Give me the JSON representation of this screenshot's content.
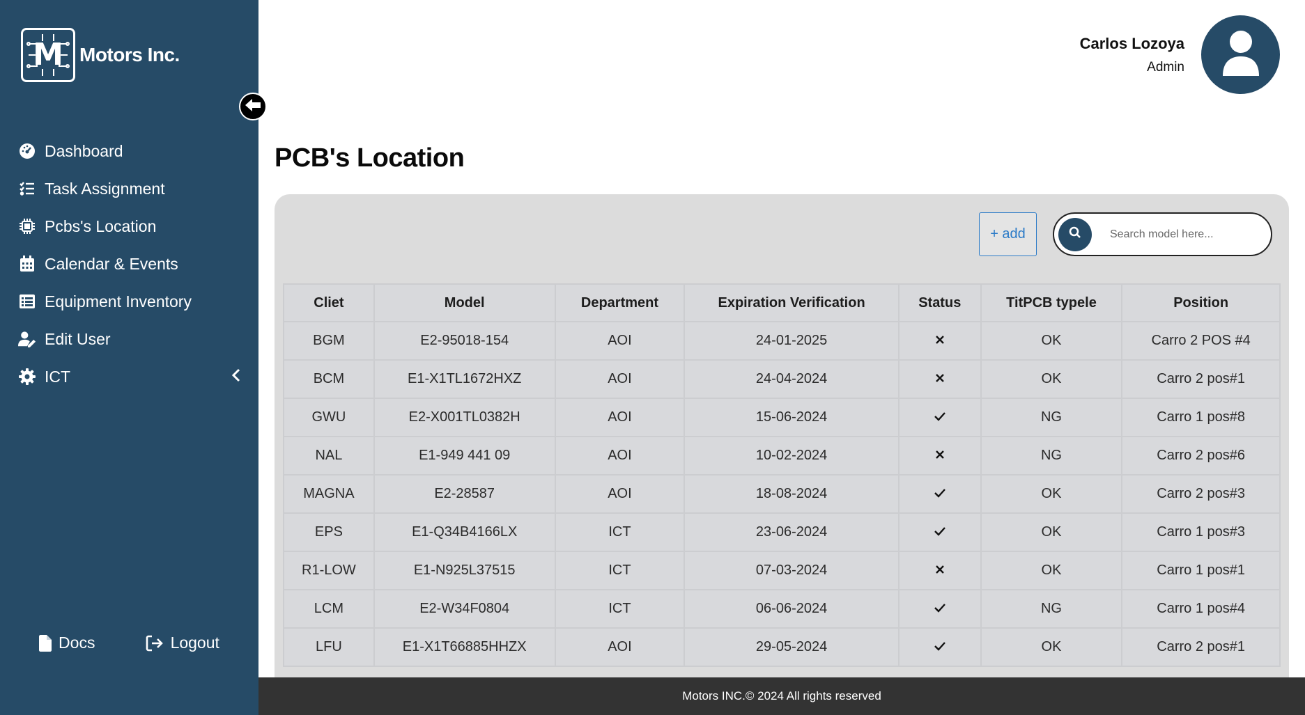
{
  "brand": {
    "logo_letter": "M",
    "name": "Motors Inc."
  },
  "sidebar": {
    "items": [
      {
        "label": "Dashboard",
        "icon": "gauge-icon"
      },
      {
        "label": "Task Assignment",
        "icon": "list-check-icon"
      },
      {
        "label": "Pcbs's Location",
        "icon": "microchip-icon"
      },
      {
        "label": "Calendar & Events",
        "icon": "calendar-icon"
      },
      {
        "label": "Equipment Inventory",
        "icon": "table-list-icon"
      },
      {
        "label": "Edit User",
        "icon": "user-pen-icon"
      },
      {
        "label": "ICT",
        "icon": "gear-icon"
      }
    ],
    "docs_label": "Docs",
    "logout_label": "Logout"
  },
  "header": {
    "user_name": "Carlos Lozoya",
    "user_role": "Admin"
  },
  "page": {
    "title": "PCB's Location"
  },
  "toolbar": {
    "add_label": "+ add",
    "search_placeholder": "Search model here..."
  },
  "table": {
    "headers": [
      "Cliet",
      "Model",
      "Department",
      "Expiration Verification",
      "Status",
      "TitPCB typele",
      "Position"
    ],
    "rows": [
      {
        "client": "BGM",
        "model": "E2-95018-154",
        "department": "AOI",
        "expiration": "24-01-2025",
        "status": "x",
        "type": "OK",
        "position": "Carro 2 POS #4"
      },
      {
        "client": "BCM",
        "model": "E1-X1TL1672HXZ",
        "department": "AOI",
        "expiration": "24-04-2024",
        "status": "x",
        "type": "OK",
        "position": "Carro 2 pos#1"
      },
      {
        "client": "GWU",
        "model": "E2-X001TL0382H",
        "department": "AOI",
        "expiration": "15-06-2024",
        "status": "check",
        "type": "NG",
        "position": "Carro 1 pos#8"
      },
      {
        "client": "NAL",
        "model": "E1-949 441 09",
        "department": "AOI",
        "expiration": "10-02-2024",
        "status": "x",
        "type": "NG",
        "position": "Carro 2 pos#6"
      },
      {
        "client": "MAGNA",
        "model": "E2-28587",
        "department": "AOI",
        "expiration": "18-08-2024",
        "status": "check",
        "type": "OK",
        "position": "Carro 2 pos#3"
      },
      {
        "client": "EPS",
        "model": "E1-Q34B4166LX",
        "department": "ICT",
        "expiration": "23-06-2024",
        "status": "check",
        "type": "OK",
        "position": "Carro 1 pos#3"
      },
      {
        "client": "R1-LOW",
        "model": "E1-N925L37515",
        "department": "ICT",
        "expiration": "07-03-2024",
        "status": "x",
        "type": "OK",
        "position": "Carro 1 pos#1"
      },
      {
        "client": "LCM",
        "model": "E2-W34F0804",
        "department": "ICT",
        "expiration": "06-06-2024",
        "status": "check",
        "type": "NG",
        "position": "Carro 1 pos#4"
      },
      {
        "client": "LFU",
        "model": "E1-X1T66885HHZX",
        "department": "AOI",
        "expiration": "29-05-2024",
        "status": "check",
        "type": "OK",
        "position": "Carro 2 pos#1"
      }
    ]
  },
  "footer": {
    "text": "Motors INC.© 2024 All rights reserved"
  },
  "colors": {
    "sidebar": "#264b67",
    "panel": "#dcdcdc",
    "footer": "#333333",
    "accent": "#2a7ac7"
  }
}
